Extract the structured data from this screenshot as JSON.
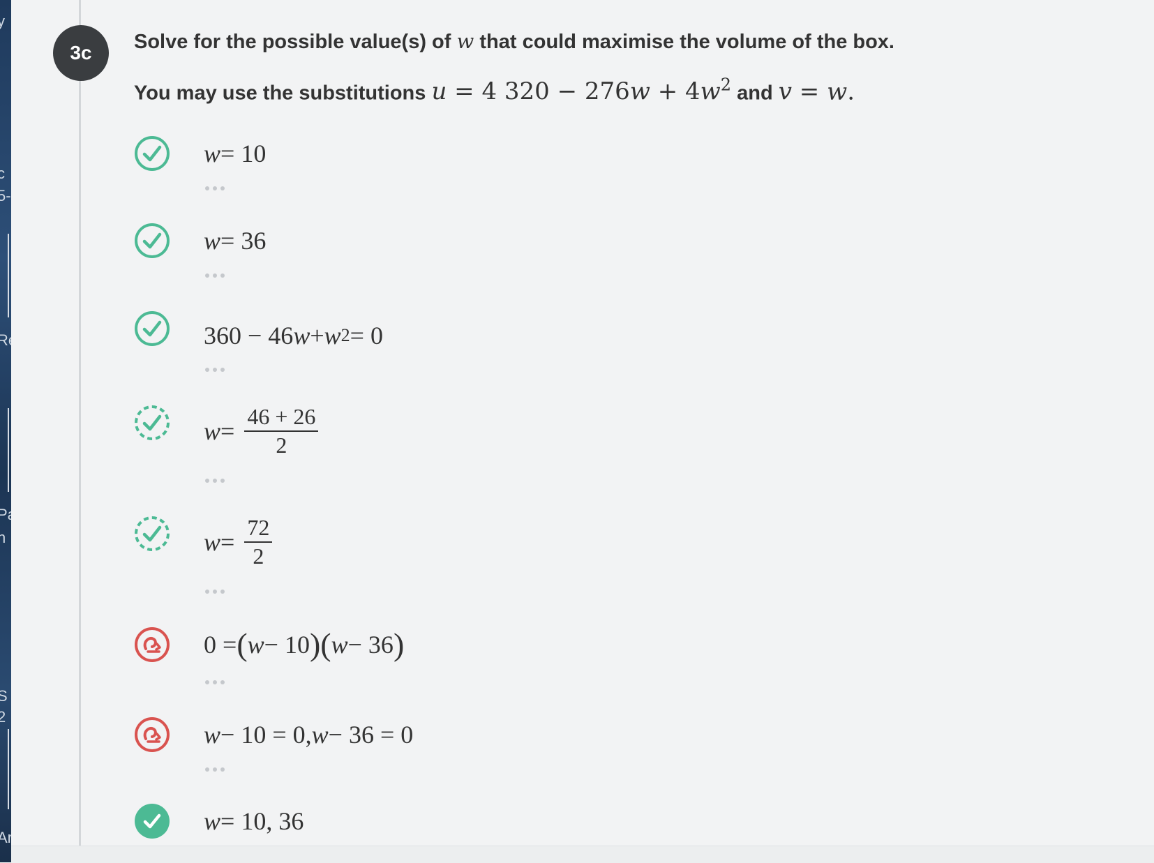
{
  "desktop_fragments": [
    "y",
    "c",
    "5-",
    "Re",
    "Pa",
    "n",
    "S",
    "2",
    "Ar"
  ],
  "step": {
    "label": "3c"
  },
  "prompt": {
    "line1_before": "Solve for the possible value(s) of",
    "line1_var": "w",
    "line1_after": "that could maximise the volume of the box.",
    "line2_before": "You may use the substitutions",
    "u_var": "u",
    "u_eq": " = 4 320 − 276",
    "u_w": "w",
    "u_plus": " + 4",
    "u_w2": "w",
    "u_exp": "2",
    "and": "and",
    "v_var": "v",
    "v_eq": " = ",
    "v_w": "w",
    "period": "."
  },
  "colors": {
    "correct": "#4cba94",
    "warning": "#d9534f",
    "badge": "#3a3d40",
    "text": "#333333"
  },
  "steps": [
    {
      "status": "correct",
      "icon": "check-circle-icon",
      "lhs": "w",
      "rhs": " = 10"
    },
    {
      "status": "correct",
      "icon": "check-circle-icon",
      "lhs": "w",
      "rhs": " = 36"
    },
    {
      "status": "correct",
      "icon": "check-circle-icon",
      "a": "360 − 46",
      "b": "w",
      "c": " + ",
      "d": "w",
      "exp": "2",
      "e": " = 0"
    },
    {
      "status": "partial",
      "icon": "dashed-check-circle-icon",
      "lhs": "w",
      "eq": " =",
      "num": "46 + 26",
      "den": "2"
    },
    {
      "status": "partial",
      "icon": "dashed-check-circle-icon",
      "lhs": "w",
      "eq": " =",
      "num": "72",
      "den": "2"
    },
    {
      "status": "error",
      "icon": "retry-circle-icon",
      "a": "0 = ",
      "w1": "w",
      "b": " − 10",
      "w2": "w",
      "c": " − 36"
    },
    {
      "status": "error",
      "icon": "retry-circle-icon",
      "w1": "w",
      "a": " − 10 = 0,  ",
      "w2": "w",
      "b": " − 36 = 0"
    },
    {
      "status": "final",
      "icon": "solid-check-circle-icon",
      "lhs": "w",
      "rhs": " = 10,  36"
    }
  ]
}
